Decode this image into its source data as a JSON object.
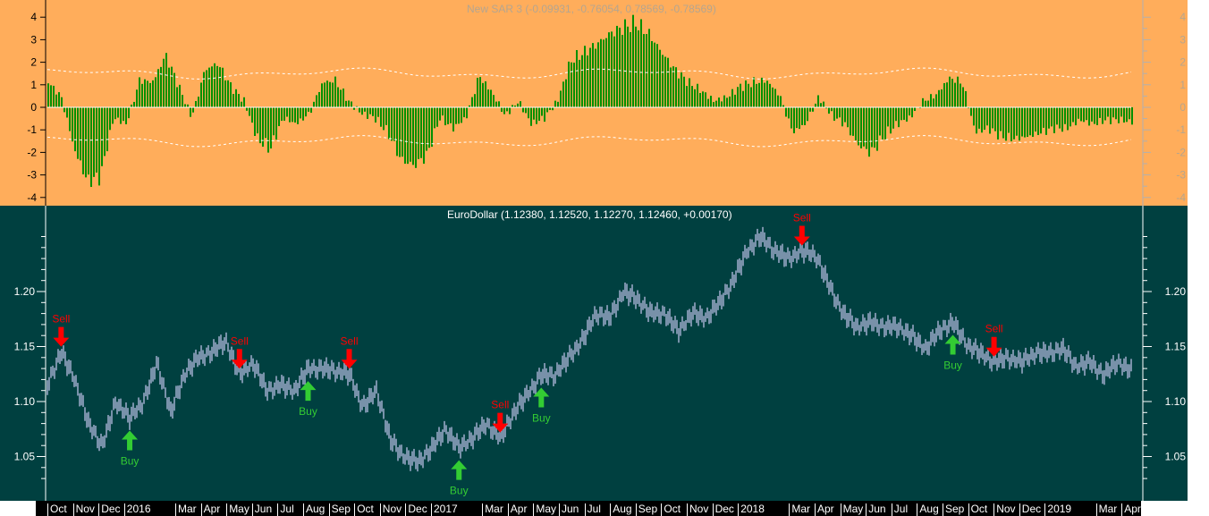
{
  "indicator_panel": {
    "title": "New SAR 3 (-0.09931, -0.76054, 0.78569, -0.78569)",
    "left_ticks": [
      "4",
      "3",
      "2",
      "1",
      "0",
      "-1",
      "-2",
      "-3",
      "-4"
    ],
    "right_ticks": [
      "4",
      "3",
      "2",
      "1",
      "0",
      "-1",
      "-2",
      "-3",
      "-4"
    ]
  },
  "price_panel": {
    "title": "EuroDollar (1.12380, 1.12520, 1.12270, 1.12460, +0.00170)",
    "left_ticks": [
      "1.20",
      "1.15",
      "1.10",
      "1.05"
    ],
    "right_ticks": [
      "1.20",
      "1.15",
      "1.10",
      "1.05"
    ]
  },
  "x_axis": {
    "labels": [
      "Oct",
      "Nov",
      "Dec",
      "2016",
      "Mar",
      "Apr",
      "May",
      "Jun",
      "Jul",
      "Aug",
      "Sep",
      "Oct",
      "Nov",
      "Dec",
      "2017",
      "Mar",
      "Apr",
      "May",
      "Jun",
      "Jul",
      "Aug",
      "Sep",
      "Oct",
      "Nov",
      "Dec",
      "2018",
      "Mar",
      "Apr",
      "May",
      "Jun",
      "Jul",
      "Aug",
      "Sep",
      "Oct",
      "Nov",
      "Dec",
      "2019",
      "Mar",
      "Apr"
    ]
  },
  "chart_data": [
    {
      "type": "bar",
      "title": "New SAR 3 (-0.09931, -0.76054, 0.78569, -0.78569)",
      "ylim": [
        -4.5,
        4.5
      ],
      "envelope": [
        1.5,
        -1.5
      ],
      "colors": {
        "histogram": "#009000",
        "line": "#0000FF",
        "envelope": "#FFFFFF"
      },
      "values": [
        1.2,
        0.5,
        -2,
        -3.5,
        -3.3,
        -0.5,
        -0.8,
        1.3,
        1.2,
        2.5,
        1.0,
        -0.5,
        1.8,
        2.1,
        1.0,
        0.3,
        -1.5,
        -2.0,
        -0.5,
        -0.8,
        -0.3,
        1.2,
        1.3,
        0.3,
        -0.3,
        -0.5,
        -1.2,
        -2.5,
        -2.8,
        -2.3,
        -0.5,
        -1.0,
        -0.5,
        1.5,
        0.7,
        -0.4,
        0.3,
        -0.8,
        -0.5,
        0.3,
        2.2,
        2.6,
        3.0,
        3.5,
        3.8,
        4.0,
        3.5,
        2.6,
        1.8,
        1.2,
        0.8,
        0.3,
        0.5,
        1.0,
        1.2,
        1.3,
        0.6,
        -1.2,
        -0.8,
        0.5,
        -0.4,
        -0.8,
        -1.8,
        -2.2,
        -1.4,
        -0.8,
        -0.5,
        0.3,
        0.6,
        1.4,
        1.2,
        -1.2,
        -1.0,
        -1.4,
        -1.5,
        -1.4,
        -1.2,
        -1.0,
        -1.0,
        -0.6,
        -0.8,
        -0.6,
        -0.6,
        -0.7
      ]
    },
    {
      "type": "line",
      "title": "EuroDollar (1.12380, 1.12520, 1.12270, 1.12460, +0.00170)",
      "ylim": [
        1.012,
        1.268
      ],
      "colors": {
        "bars": "#C8C8F0",
        "buy": "#33CC33",
        "sell": "#FF0000"
      },
      "closes": [
        1.115,
        1.145,
        1.12,
        1.08,
        1.06,
        1.1,
        1.085,
        1.1,
        1.135,
        1.09,
        1.125,
        1.14,
        1.145,
        1.155,
        1.125,
        1.135,
        1.11,
        1.115,
        1.11,
        1.13,
        1.13,
        1.128,
        1.125,
        1.095,
        1.11,
        1.065,
        1.05,
        1.045,
        1.057,
        1.075,
        1.058,
        1.067,
        1.08,
        1.067,
        1.09,
        1.107,
        1.124,
        1.124,
        1.14,
        1.156,
        1.18,
        1.176,
        1.2,
        1.193,
        1.18,
        1.18,
        1.164,
        1.18,
        1.176,
        1.19,
        1.21,
        1.237,
        1.25,
        1.237,
        1.23,
        1.237,
        1.233,
        1.205,
        1.18,
        1.168,
        1.172,
        1.168,
        1.168,
        1.16,
        1.148,
        1.164,
        1.172,
        1.152,
        1.144,
        1.136,
        1.14,
        1.136,
        1.144,
        1.144,
        1.148,
        1.132,
        1.136,
        1.124,
        1.136,
        1.128
      ],
      "signals": [
        {
          "type": "sell",
          "index": 1,
          "label": "Sell"
        },
        {
          "type": "buy",
          "index": 6,
          "label": "Buy"
        },
        {
          "type": "sell",
          "index": 14,
          "label": "Sell"
        },
        {
          "type": "buy",
          "index": 19,
          "label": "Buy"
        },
        {
          "type": "sell",
          "index": 22,
          "label": "Sell"
        },
        {
          "type": "buy",
          "index": 30,
          "label": "Buy"
        },
        {
          "type": "sell",
          "index": 33,
          "label": "Sell"
        },
        {
          "type": "buy",
          "index": 36,
          "label": "Buy"
        },
        {
          "type": "sell",
          "index": 55,
          "label": "Sell"
        },
        {
          "type": "buy",
          "index": 66,
          "label": "Buy"
        },
        {
          "type": "sell",
          "index": 69,
          "label": "Sell"
        }
      ]
    }
  ]
}
